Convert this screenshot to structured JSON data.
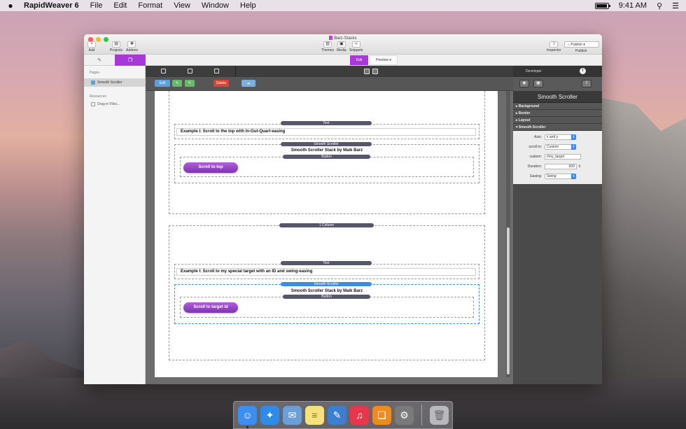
{
  "menubar": {
    "app_name": "RapidWeaver 6",
    "menus": [
      "File",
      "Edit",
      "Format",
      "View",
      "Window",
      "Help"
    ],
    "clock": "9:41 AM"
  },
  "window": {
    "title": "Barz-Stacks",
    "toolbar": {
      "add": "Add",
      "projects": "Projects",
      "addons": "Addons",
      "themes": "Themes",
      "media": "Media",
      "snippets": "Snippets",
      "inspector": "Inspector",
      "publish_button": "Publish",
      "publish": "Publish"
    },
    "mode": {
      "edit": "Edit",
      "preview": "Preview"
    }
  },
  "sidebar": {
    "pages_header": "Pages",
    "page_item": "Smooth Scroller",
    "resources_header": "Resources",
    "drag_in": "Drag in Files..."
  },
  "editor": {
    "toolbar": {
      "edit": "Edit",
      "delete": "Delete"
    },
    "stacks": {
      "text_pill": "Text",
      "example1": "Example I: Scroll to the top with In-Out-Quart-easing",
      "smooth_pill": "Smooth Scroller",
      "stack_title": "Smooth Scroller Stack by Maik Barz",
      "button_pill": "Button",
      "button1": "Scroll to top",
      "column_pill": "1 Column",
      "text_pill2": "Text",
      "example2": "Example I: Scroll to my special target with an ID and swing-easing",
      "smooth_pill2": "Smooth Scroller",
      "stack_title2": "Smooth Scroller Stack by Maik Barz",
      "button_pill2": "Button",
      "button2": "Scroll to target id"
    }
  },
  "inspector": {
    "developer": "Developer",
    "title": "Smooth Scroller",
    "sections": [
      "Background",
      "Border",
      "Layout",
      "Smooth Scroller"
    ],
    "props": {
      "axis_label": "Axis:",
      "axis_value": "x and y",
      "scroll_to_label": "scroll to:",
      "scroll_to_value": "Custom",
      "custom_label": "custom:",
      "custom_value": "#my_target",
      "duration_label": "Duration:",
      "duration_value": "600",
      "easing_label": "Easing:",
      "easing_value": "Swing"
    }
  },
  "dock": {
    "apps": [
      {
        "name": "finder-icon",
        "color": "#3a8ff0",
        "glyph": "☺"
      },
      {
        "name": "safari-icon",
        "color": "#2f8be8",
        "glyph": "✦"
      },
      {
        "name": "mail-icon",
        "color": "#6c9fd8",
        "glyph": "✉"
      },
      {
        "name": "notes-icon",
        "color": "#f5e27a",
        "glyph": "≡"
      },
      {
        "name": "rapidweaver-icon",
        "color": "#3c7fd0",
        "glyph": "✎"
      },
      {
        "name": "itunes-icon",
        "color": "#e8364a",
        "glyph": "♫"
      },
      {
        "name": "ibooks-icon",
        "color": "#f08a1e",
        "glyph": "❏"
      },
      {
        "name": "system-preferences-icon",
        "color": "#7a7a7a",
        "glyph": "⚙"
      }
    ]
  },
  "colors": {
    "accent_purple": "#a739d8",
    "button_purple": "#8a3fc2",
    "pill_dark": "#58566b",
    "pill_blue": "#3d89f2",
    "delete_red": "#d9443a",
    "edit_blue": "#5fa0dc"
  }
}
